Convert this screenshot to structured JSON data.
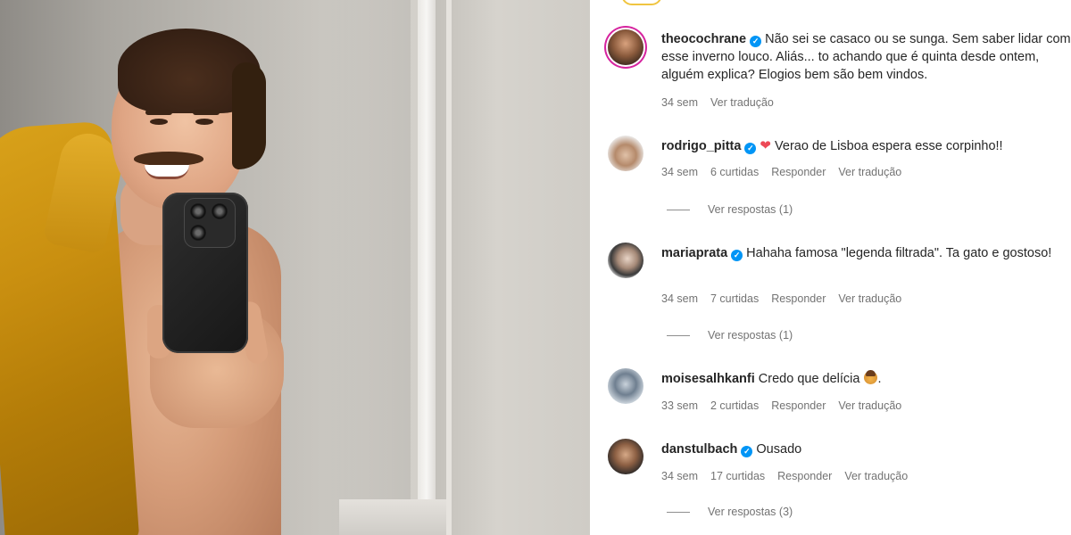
{
  "post": {
    "caption_author": {
      "username": "theocochrane",
      "text": "Não sei se casaco ou se sunga. Sem saber lidar com esse inverno louco. Aliás... to achando que é quinta desde ontem, alguém explica? Elogios bem são bem vindos.",
      "time": "34 sem",
      "translate_label": "Ver tradução"
    }
  },
  "comments": [
    {
      "username": "rodrigo_pitta",
      "verified": true,
      "text": "Verao de Lisboa espera esse corpinho!!",
      "time": "34 sem",
      "likes": "6 curtidas",
      "reply_label": "Responder",
      "translate_label": "Ver tradução",
      "view_replies": "Ver respostas (1)"
    },
    {
      "username": "mariaprata",
      "verified": true,
      "text": "Hahaha famosa \"legenda filtrada\". Ta gato e gostoso!",
      "time": "34 sem",
      "likes": "7 curtidas",
      "reply_label": "Responder",
      "translate_label": "Ver tradução",
      "view_replies": "Ver respostas (1)"
    },
    {
      "username": "moisesalhkanfi",
      "verified": false,
      "text": "Credo que delícia",
      "time": "33 sem",
      "likes": "2 curtidas",
      "reply_label": "Responder",
      "translate_label": "Ver tradução"
    },
    {
      "username": "danstulbach",
      "verified": true,
      "text": "Ousado",
      "time": "34 sem",
      "likes": "17 curtidas",
      "reply_label": "Responder",
      "translate_label": "Ver tradução",
      "view_replies": "Ver respostas (3)"
    }
  ],
  "icons": {
    "verified": "verified-badge-icon",
    "heart": "red-heart-emoji",
    "see_no_evil": "see-no-evil-monkey-emoji"
  },
  "colors": {
    "verified_blue": "#0095f6",
    "meta_gray": "#737373",
    "text_dark": "#262626",
    "heart_red": "#ed4956"
  }
}
